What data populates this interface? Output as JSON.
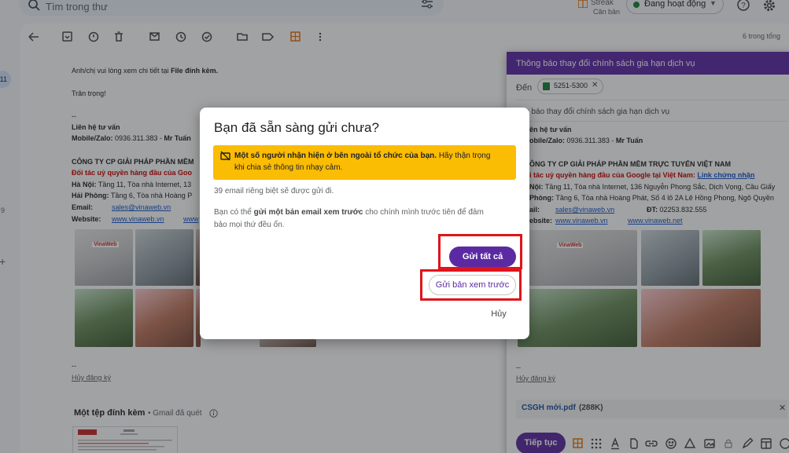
{
  "topbar": {
    "search_placeholder": "Tìm trong thư",
    "streak_name": "Streak",
    "streak_sub": "Căn bản",
    "status": "Đang hoạt động"
  },
  "rail": {
    "badge": "11",
    "number": "9"
  },
  "toolbar": {
    "count": "6 trong tổng"
  },
  "email": {
    "intro": "Anh/chị vui lòng xem chi tiết tại ",
    "intro_bold": "File đính kèm.",
    "regards": "Trân trọng!",
    "dashes": "--",
    "contact_title": "Liên hệ tư vấn",
    "contact_label": "Mobile/Zalo:",
    "contact_value": " 0936.311.383 - ",
    "contact_name": "Mr Tuấn",
    "company": "CÔNG TY CP GIẢI PHÁP PHẦN MỀM",
    "partner": "Đối tác uỷ quyền hàng đầu của Goo",
    "hanoi_label": "Hà Nội:",
    "hanoi_value": " Tầng 11, Tòa nhà Internet, 13",
    "haiphong_label": "Hải Phòng:",
    "haiphong_value": " Tầng 6, Tòa nhà Hoàng P",
    "email_label": "Email:",
    "email_value": "sales@vinaweb.vn",
    "website_label": "Website:",
    "website_value": "www.vinaweb.vn",
    "website_value2": "www",
    "sig_dashes": "--",
    "unsubscribe": "Hủy đăng ký",
    "attach_title": "Một tệp đính kèm",
    "attach_note": "• Gmail đã quét",
    "photo_logo": "VinaWeb"
  },
  "compose": {
    "title": "Thông báo thay đổi chính sách gia hạn dịch vụ",
    "to_label": "Đến",
    "to_chip": "5251-5300",
    "subject": "ông báo thay đổi chính sách gia hạn dịch vụ",
    "contact_title": "ên hệ tư vấn",
    "contact_label": "obile/Zalo:",
    "contact_value": " 0936.311.383 - ",
    "contact_name": "Mr Tuấn",
    "company": "ÔNG TY CP GIẢI PHÁP PHẦN MỀM TRỰC TUYẾN VIỆT NAM",
    "partner": "i tác uỷ quyền hàng đầu của Google tại Việt Nam: ",
    "partner_link": "Link chứng nhận",
    "hanoi_label": "Nội:",
    "hanoi_value": " Tầng 11, Tòa nhà Internet, 136 Nguyễn Phong Sắc, Dịch Vọng, Cầu Giấy",
    "haiphong_label": "Phòng:",
    "haiphong_value": " Tầng 6, Tòa nhà Hoàng Phát, Số 4 lô 2A Lê Hồng Phong, Ngô Quyền",
    "email_label": "ail:",
    "email_value": "sales@vinaweb.vn",
    "phone_label": "ĐT:",
    "phone_value": " 02253.832.555",
    "website_label": "ebsite:",
    "website_value": "www.vinaweb.vn",
    "website_value2": "www.vinaweb.net",
    "sig_dashes": "--",
    "unsubscribe": "Hủy đăng ký",
    "attachment_name": "CSGH mới.pdf",
    "attachment_size": "(288K)",
    "continue_label": "Tiếp tục"
  },
  "dialog": {
    "title": "Bạn đã sẵn sàng gửi chưa?",
    "warning_bold": "Một số người nhận hiện ở bên ngoài tổ chức của bạn.",
    "warning_rest": " Hãy thận trọng",
    "warning_line2": "khi chia sẻ thông tin nhạy cảm.",
    "recipients": "39 email riêng biệt sẽ được gửi đi.",
    "preview_pre": "Bạn có thể ",
    "preview_bold": "gửi một bản email xem trước",
    "preview_post": " cho chính mình trước tiên để đảm",
    "preview_line2": "bảo mọi thứ đều ổn.",
    "send_all": "Gửi tất cả",
    "send_preview": "Gửi bản xem trước",
    "cancel": "Hủy"
  },
  "colors": {
    "accent": "#5b2aa3",
    "compose_header": "#5e2aa8",
    "warning": "#fbbc04",
    "highlight": "#e0141b"
  }
}
